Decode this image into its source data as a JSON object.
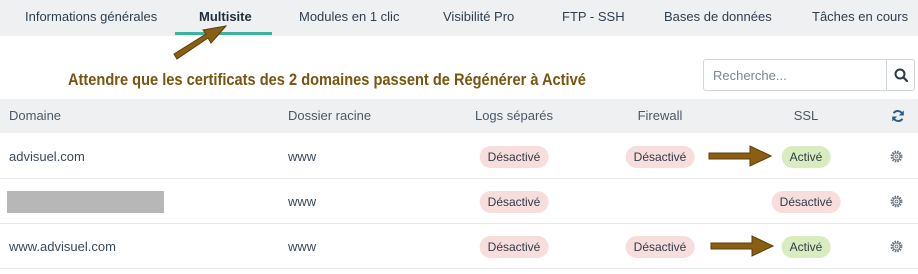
{
  "tabs": [
    {
      "label": "Informations générales",
      "active": false
    },
    {
      "label": "Multisite",
      "active": true
    },
    {
      "label": "Modules en 1 clic",
      "active": false
    },
    {
      "label": "Visibilité Pro",
      "active": false
    },
    {
      "label": "FTP - SSH",
      "active": false
    },
    {
      "label": "Bases de données",
      "active": false
    },
    {
      "label": "Tâches en cours",
      "active": false
    }
  ],
  "annotation": {
    "text": "Attendre que les certificats des 2 domaines passent de Régénérer à Activé",
    "color": "#7a5410"
  },
  "search": {
    "placeholder": "Recherche...",
    "value": "",
    "icon": "search-icon"
  },
  "table": {
    "headers": {
      "domain": "Domaine",
      "folder": "Dossier racine",
      "logs": "Logs séparés",
      "firewall": "Firewall",
      "ssl": "SSL"
    },
    "refresh_icon": "refresh-icon",
    "rows": [
      {
        "domain": "advisuel.com",
        "redacted": false,
        "folder": "www",
        "logs": "Désactivé",
        "firewall": "Désactivé",
        "ssl": "Activé"
      },
      {
        "domain": "",
        "redacted": true,
        "folder": "www",
        "logs": "Désactivé",
        "firewall": "",
        "ssl": "Désactivé"
      },
      {
        "domain": "www.advisuel.com",
        "redacted": false,
        "folder": "www",
        "logs": "Désactivé",
        "firewall": "Désactivé",
        "ssl": "Activé"
      }
    ],
    "row_action_icon": "gear-icon"
  },
  "colors": {
    "accent": "#3db39e",
    "badge_off_bg": "#f8dddd",
    "badge_on_bg": "#d9ecc0",
    "annotation_arrow": "#8a5f14"
  }
}
